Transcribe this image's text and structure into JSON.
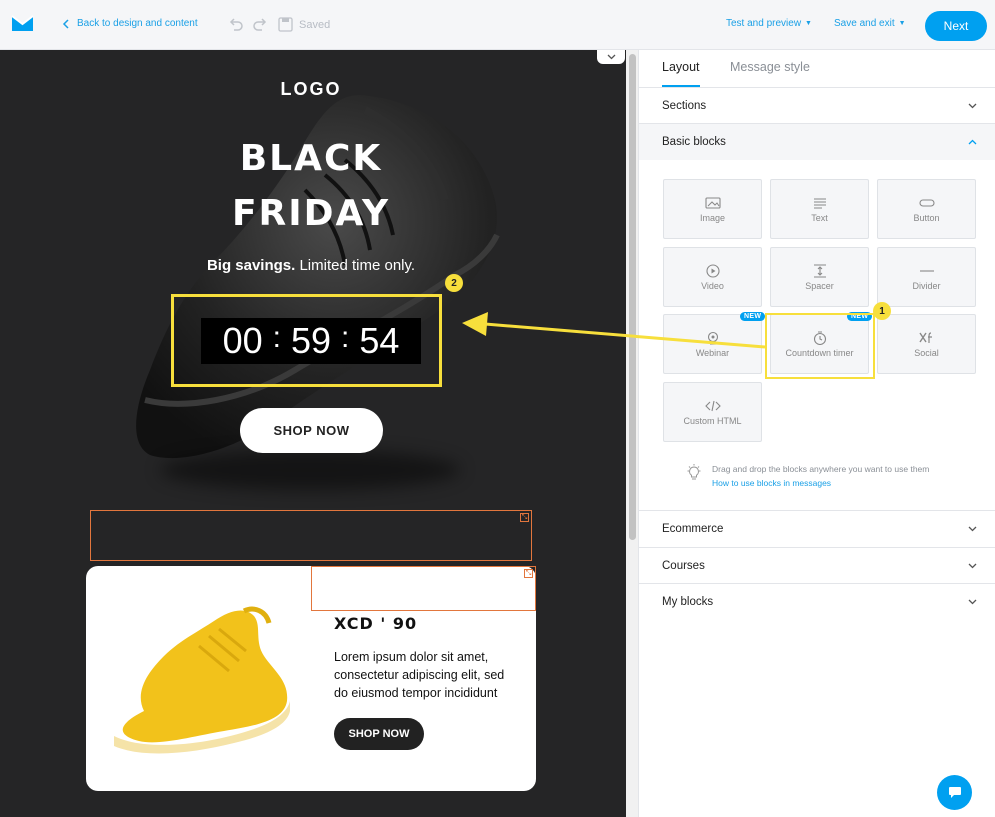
{
  "topbar": {
    "back_label": "Back to design and content",
    "saved_label": "Saved",
    "test_preview_label": "Test and preview",
    "save_exit_label": "Save and exit",
    "next_label": "Next"
  },
  "email": {
    "logo": "LOGO",
    "headline_line1": "BLACK",
    "headline_line2": "FRIDAY",
    "tagline_bold": "Big savings.",
    "tagline_rest": " Limited time only.",
    "timer": {
      "hours": "00",
      "minutes": "59",
      "seconds": "54",
      "separator": ":"
    },
    "shop_now": "SHOP NOW",
    "product": {
      "title": "XCD ' 90",
      "description": "Lorem ipsum dolor sit amet, consectetur adipiscing elit, sed do eiusmod tempor incididunt",
      "button": "SHOP NOW"
    }
  },
  "panel": {
    "tabs": [
      {
        "label": "Layout",
        "active": true
      },
      {
        "label": "Message style",
        "active": false
      }
    ],
    "sections_label": "Sections",
    "basic_blocks_label": "Basic blocks",
    "blocks": [
      {
        "label": "Image",
        "icon": "image-icon"
      },
      {
        "label": "Text",
        "icon": "text-icon"
      },
      {
        "label": "Button",
        "icon": "button-icon"
      },
      {
        "label": "Video",
        "icon": "video-icon"
      },
      {
        "label": "Spacer",
        "icon": "spacer-icon"
      },
      {
        "label": "Divider",
        "icon": "divider-icon"
      },
      {
        "label": "Webinar",
        "icon": "webinar-icon",
        "badge": "NEW"
      },
      {
        "label": "Countdown timer",
        "icon": "timer-icon",
        "badge": "NEW"
      },
      {
        "label": "Social",
        "icon": "social-icon"
      },
      {
        "label": "Custom HTML",
        "icon": "code-icon"
      }
    ],
    "hint_text": "Drag and drop the blocks anywhere you want to use them",
    "hint_link": "How to use blocks in messages",
    "ecommerce_label": "Ecommerce",
    "courses_label": "Courses",
    "my_blocks_label": "My blocks"
  },
  "annotations": {
    "badge1": "1",
    "badge2": "2",
    "highlight_color": "#f7df3c"
  },
  "colors": {
    "accent": "#00a0f0",
    "selection": "#e2763d",
    "canvas_bg": "#252526"
  }
}
